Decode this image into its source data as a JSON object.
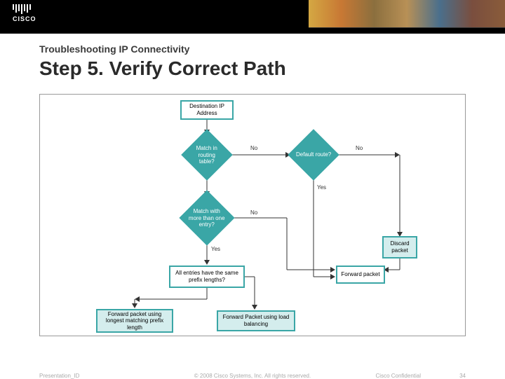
{
  "header": {
    "subtitle": "Troubleshooting IP Connectivity",
    "title": "Step 5. Verify Correct Path"
  },
  "logo": {
    "text": "CISCO"
  },
  "flowchart": {
    "n_destip": "Destination IP\nAddress",
    "n_match_table": "Match in routing\ntable?",
    "n_default": "Default route?",
    "n_multi": "Match with\nmore than one\nentry?",
    "n_discard": "Discard\npacket",
    "n_prefix": "All entries have the same\nprefix lengths?",
    "n_fwd": "Forward packet",
    "n_longest": "Forward packet using\nlongest matching prefix\nlength",
    "n_loadbal": "Forward Packet using load\nbalancing",
    "edge_no": "No",
    "edge_yes": "Yes"
  },
  "footer": {
    "left": "Presentation_ID",
    "center": "© 2008 Cisco Systems, Inc. All rights reserved.",
    "right1": "Cisco Confidential",
    "right2": "34"
  }
}
